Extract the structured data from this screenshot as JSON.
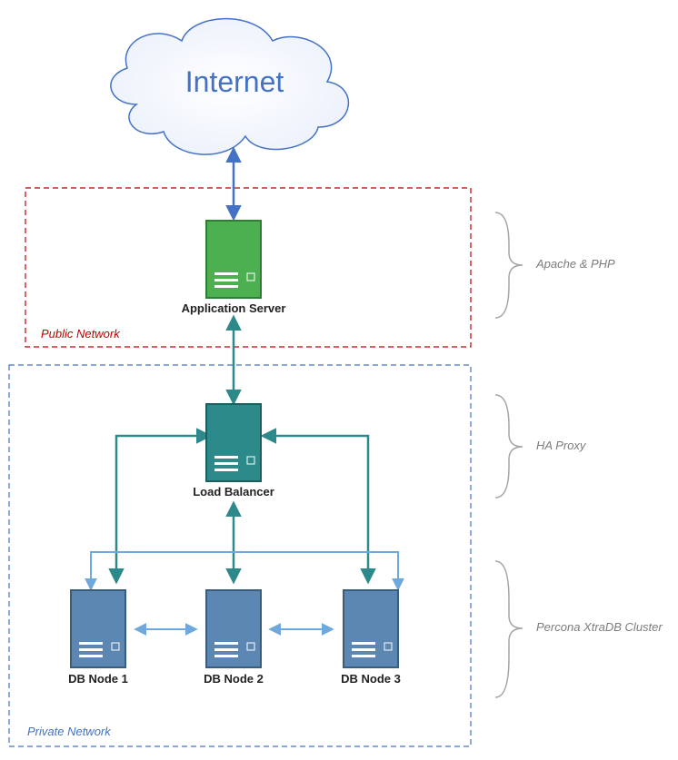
{
  "cloud": {
    "label": "Internet"
  },
  "zones": {
    "public": {
      "label": "Public Network",
      "color": "#c00000"
    },
    "private": {
      "label": "Private Network",
      "color": "#4472c4"
    }
  },
  "nodes": {
    "app": {
      "label": "Application Server",
      "color": "#4CAF50",
      "dark": "#2e7d32"
    },
    "lb": {
      "label": "Load Balancer",
      "color": "#2d8a8a",
      "dark": "#1e5e5e"
    },
    "db1": {
      "label": "DB Node 1",
      "color": "#5b87b2",
      "dark": "#3b5d7d"
    },
    "db2": {
      "label": "DB Node 2",
      "color": "#5b87b2",
      "dark": "#3b5d7d"
    },
    "db3": {
      "label": "DB Node 3",
      "color": "#5b87b2",
      "dark": "#3b5d7d"
    }
  },
  "annotations": {
    "app": "Apache & PHP",
    "lb": "HA Proxy",
    "db": "Percona XtraDB Cluster"
  },
  "connections": {
    "internet_app": {
      "color": "#4472c4"
    },
    "app_lb": {
      "color": "#2d8a8a"
    },
    "lb_branches": {
      "color": "#2d8a8a"
    },
    "db_ring": {
      "color": "#6fa8dc"
    }
  }
}
